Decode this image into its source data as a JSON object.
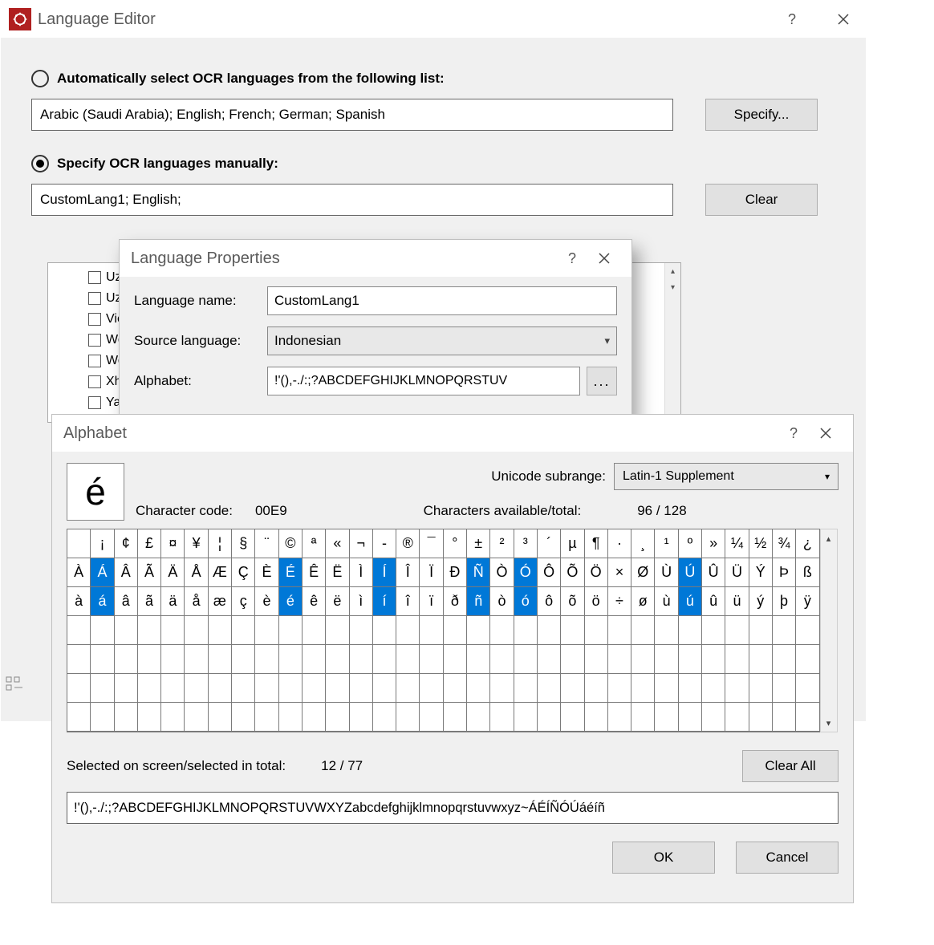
{
  "main": {
    "title": "Language Editor",
    "radio_auto_label": "Automatically select OCR languages from the following list:",
    "radio_manual_label": "Specify OCR languages manually:",
    "radio_selected": "manual",
    "auto_langs_value": "Arabic (Saudi Arabia); English; French; German; Spanish",
    "manual_langs_value": "CustomLang1; English;",
    "specify_btn": "Specify...",
    "clear_btn": "Clear",
    "lang_list": [
      "Uzb",
      "Uzb",
      "Viet",
      "Wel",
      "Wol",
      "Xho",
      "Yak"
    ]
  },
  "props": {
    "title": "Language Properties",
    "name_label": "Language name:",
    "name_value": "CustomLang1",
    "src_label": "Source language:",
    "src_value": "Indonesian",
    "alpha_label": "Alphabet:",
    "alpha_value": "!'(),-./:;?ABCDEFGHIJKLMNOPQRSTUV",
    "ellipsis": "..."
  },
  "alpha": {
    "title": "Alphabet",
    "preview_char": "é",
    "char_code_label": "Character code:",
    "char_code_value": "00E9",
    "avail_label": "Characters available/total:",
    "avail_value": "96 / 128",
    "subrange_label": "Unicode subrange:",
    "subrange_value": "Latin-1 Supplement",
    "selected_screen_label": "Selected on screen/selected in total:",
    "selected_screen_value": "12 / 77",
    "clear_all": "Clear All",
    "full_alphabet": "!'(),-./:;?ABCDEFGHIJKLMNOPQRSTUVWXYZabcdefghijklmnopqrstuvwxyz~ÁÉÍÑÓÚáéíñ",
    "ok_btn": "OK",
    "cancel_btn": "Cancel",
    "rows": [
      [
        "",
        "¡",
        "¢",
        "£",
        "¤",
        "¥",
        "¦",
        "§",
        "¨",
        "©",
        "ª",
        "«",
        "¬",
        "‑",
        "®",
        "¯",
        "°",
        "±",
        "²",
        "³",
        "´",
        "µ",
        "¶",
        "·",
        "¸",
        "¹",
        "º",
        "»",
        "¼",
        "½",
        "¾",
        "¿"
      ],
      [
        "À",
        "Á",
        "Â",
        "Ã",
        "Ä",
        "Å",
        "Æ",
        "Ç",
        "È",
        "É",
        "Ê",
        "Ë",
        "Ì",
        "Í",
        "Î",
        "Ï",
        "Đ",
        "Ñ",
        "Ò",
        "Ó",
        "Ô",
        "Õ",
        "Ö",
        "×",
        "Ø",
        "Ù",
        "Ú",
        "Û",
        "Ü",
        "Ý",
        "Þ",
        "ß"
      ],
      [
        "à",
        "á",
        "â",
        "ã",
        "ä",
        "å",
        "æ",
        "ç",
        "è",
        "é",
        "ê",
        "ë",
        "ì",
        "í",
        "î",
        "ï",
        "ð",
        "ñ",
        "ò",
        "ó",
        "ô",
        "õ",
        "ö",
        "÷",
        "ø",
        "ù",
        "ú",
        "û",
        "ü",
        "ý",
        "þ",
        "ÿ"
      ],
      [
        "",
        "",
        "",
        "",
        "",
        "",
        "",
        "",
        "",
        "",
        "",
        "",
        "",
        "",
        "",
        "",
        "",
        "",
        "",
        "",
        "",
        "",
        "",
        "",
        "",
        "",
        "",
        "",
        "",
        "",
        "",
        ""
      ],
      [
        "",
        "",
        "",
        "",
        "",
        "",
        "",
        "",
        "",
        "",
        "",
        "",
        "",
        "",
        "",
        "",
        "",
        "",
        "",
        "",
        "",
        "",
        "",
        "",
        "",
        "",
        "",
        "",
        "",
        "",
        "",
        ""
      ],
      [
        "",
        "",
        "",
        "",
        "",
        "",
        "",
        "",
        "",
        "",
        "",
        "",
        "",
        "",
        "",
        "",
        "",
        "",
        "",
        "",
        "",
        "",
        "",
        "",
        "",
        "",
        "",
        "",
        "",
        "",
        "",
        ""
      ],
      [
        "",
        "",
        "",
        "",
        "",
        "",
        "",
        "",
        "",
        "",
        "",
        "",
        "",
        "",
        "",
        "",
        "",
        "",
        "",
        "",
        "",
        "",
        "",
        "",
        "",
        "",
        "",
        "",
        "",
        "",
        "",
        ""
      ]
    ],
    "selected_cells": [
      [
        1,
        1
      ],
      [
        1,
        9
      ],
      [
        1,
        13
      ],
      [
        1,
        17
      ],
      [
        1,
        19
      ],
      [
        1,
        26
      ],
      [
        2,
        1
      ],
      [
        2,
        9
      ],
      [
        2,
        13
      ],
      [
        2,
        17
      ],
      [
        2,
        19
      ],
      [
        2,
        26
      ]
    ]
  }
}
